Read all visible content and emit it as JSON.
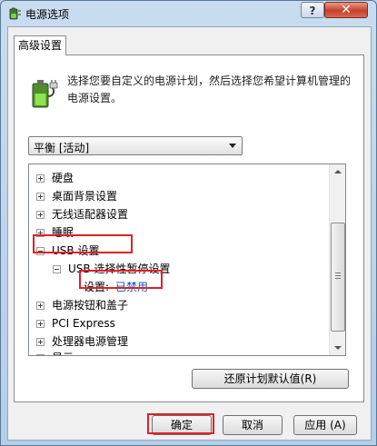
{
  "window": {
    "title": "电源选项",
    "help_label": "?",
    "close_label": "✕"
  },
  "tab": {
    "label": "高级设置"
  },
  "description": "选择您要自定义的电源计划，然后选择您希望计算机管理的电源设置。",
  "plan_select": {
    "value": "平衡 [活动]"
  },
  "tree": {
    "items": [
      {
        "label": "硬盘",
        "expander": "+"
      },
      {
        "label": "桌面背景设置",
        "expander": "+"
      },
      {
        "label": "无线适配器设置",
        "expander": "+"
      },
      {
        "label": "睡眠",
        "expander": "+"
      },
      {
        "label": "USB 设置",
        "expander": "-"
      },
      {
        "label": "USB 选择性暂停设置",
        "expander": "-"
      },
      {
        "label": "设置:",
        "value": "已禁用"
      },
      {
        "label": "电源按钮和盖子",
        "expander": "+"
      },
      {
        "label": "PCI Express",
        "expander": "+"
      },
      {
        "label": "处理器电源管理",
        "expander": "+"
      },
      {
        "label": "显示",
        "expander": "+"
      }
    ]
  },
  "buttons": {
    "restore_defaults": "还原计划默认值(R)",
    "ok": "确定",
    "cancel": "取消",
    "apply": "应用 (A)"
  },
  "colors": {
    "highlight": "#e0202a",
    "setting_value": "#0a57c2",
    "close_button": "#c5402b"
  },
  "icons": {
    "title": "power-options-icon",
    "panel": "battery-plug-icon"
  }
}
